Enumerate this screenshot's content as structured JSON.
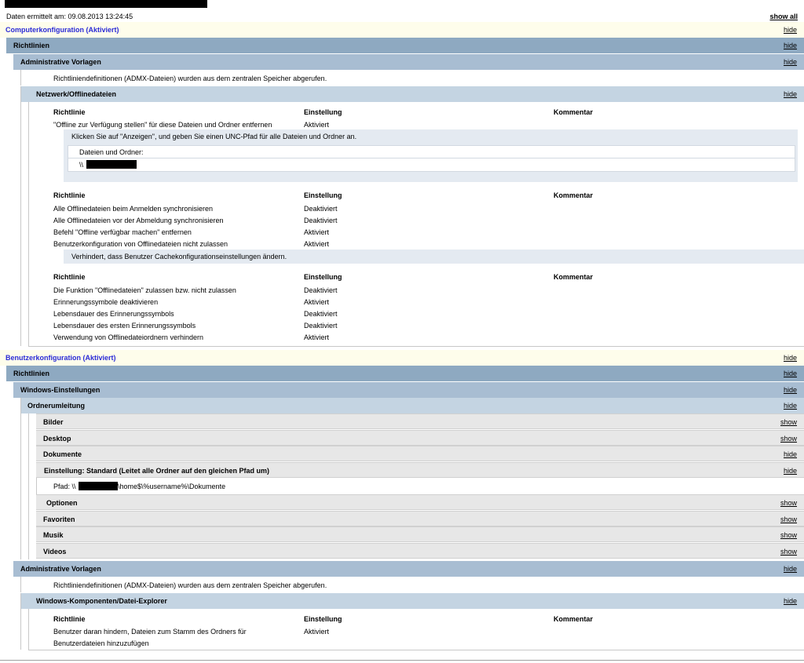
{
  "header": {
    "date_text": "Daten ermittelt am: 09.08.2013 13:24:45",
    "show_all": "show all"
  },
  "links": {
    "hide": "hide",
    "show": "show"
  },
  "computer": {
    "title": "Computerkonfiguration (Aktiviert)",
    "policies": "Richtlinien",
    "admin_templates": "Administrative Vorlagen",
    "admx_note": "Richtliniendefinitionen (ADMX-Dateien) wurden aus dem zentralen Speicher abgerufen.",
    "offline_title": "Netzwerk/Offlinedateien",
    "col_policy": "Richtlinie",
    "col_setting": "Einstellung",
    "col_comment": "Kommentar",
    "g1": [
      {
        "policy": "\"Offline zur Verfügung stellen\" für diese Dateien und Ordner entfernen",
        "setting": "Aktiviert"
      }
    ],
    "g1_explain": "Klicken Sie auf \"Anzeigen\", und geben Sie einen UNC-Pfad für alle Dateien und Ordner an.",
    "g1_box_label": "Dateien und Ordner:",
    "g1_box_value": "\\\\",
    "g2": [
      {
        "policy": "Alle Offlinedateien beim Anmelden synchronisieren",
        "setting": "Deaktiviert"
      },
      {
        "policy": "Alle Offlinedateien vor der Abmeldung synchronisieren",
        "setting": "Deaktiviert"
      },
      {
        "policy": "Befehl \"Offline verfügbar machen\" entfernen",
        "setting": "Aktiviert"
      },
      {
        "policy": "Benutzerkonfiguration von Offlinedateien nicht zulassen",
        "setting": "Aktiviert"
      }
    ],
    "g2_explain": "Verhindert, dass Benutzer Cachekonfigurationseinstellungen ändern.",
    "g3": [
      {
        "policy": "Die Funktion \"Offlinedateien\" zulassen bzw. nicht zulassen",
        "setting": "Deaktiviert"
      },
      {
        "policy": "Erinnerungssymbole deaktivieren",
        "setting": "Aktiviert"
      },
      {
        "policy": "Lebensdauer des Erinnerungssymbols",
        "setting": "Deaktiviert"
      },
      {
        "policy": "Lebensdauer des ersten Erinnerungssymbols",
        "setting": "Deaktiviert"
      },
      {
        "policy": "Verwendung von Offlinedateiordnern verhindern",
        "setting": "Aktiviert"
      }
    ]
  },
  "user": {
    "title": "Benutzerkonfiguration (Aktiviert)",
    "policies": "Richtlinien",
    "windows_settings": "Windows-Einstellungen",
    "folder_redirect": "Ordnerumleitung",
    "folders": {
      "bilder": "Bilder",
      "desktop": "Desktop",
      "dokumente": "Dokumente",
      "setting": "Einstellung: Standard (Leitet alle Ordner auf den gleichen Pfad um)",
      "path_prefix": "Pfad: \\\\",
      "path_suffix": "\\home$\\%username%\\Dokumente",
      "optionen": "Optionen",
      "favoriten": "Favoriten",
      "musik": "Musik",
      "videos": "Videos"
    },
    "admin_templates": "Administrative Vorlagen",
    "admx_note": "Richtliniendefinitionen (ADMX-Dateien) wurden aus dem zentralen Speicher abgerufen.",
    "explorer_title": "Windows-Komponenten/Datei-Explorer",
    "col_policy": "Richtlinie",
    "col_setting": "Einstellung",
    "col_comment": "Kommentar",
    "row_policy_line1": "Benutzer daran hindern, Dateien zum Stamm des Ordners für",
    "row_policy_line2": "Benutzerdateien hinzuzufügen",
    "row_setting": "Aktiviert"
  }
}
